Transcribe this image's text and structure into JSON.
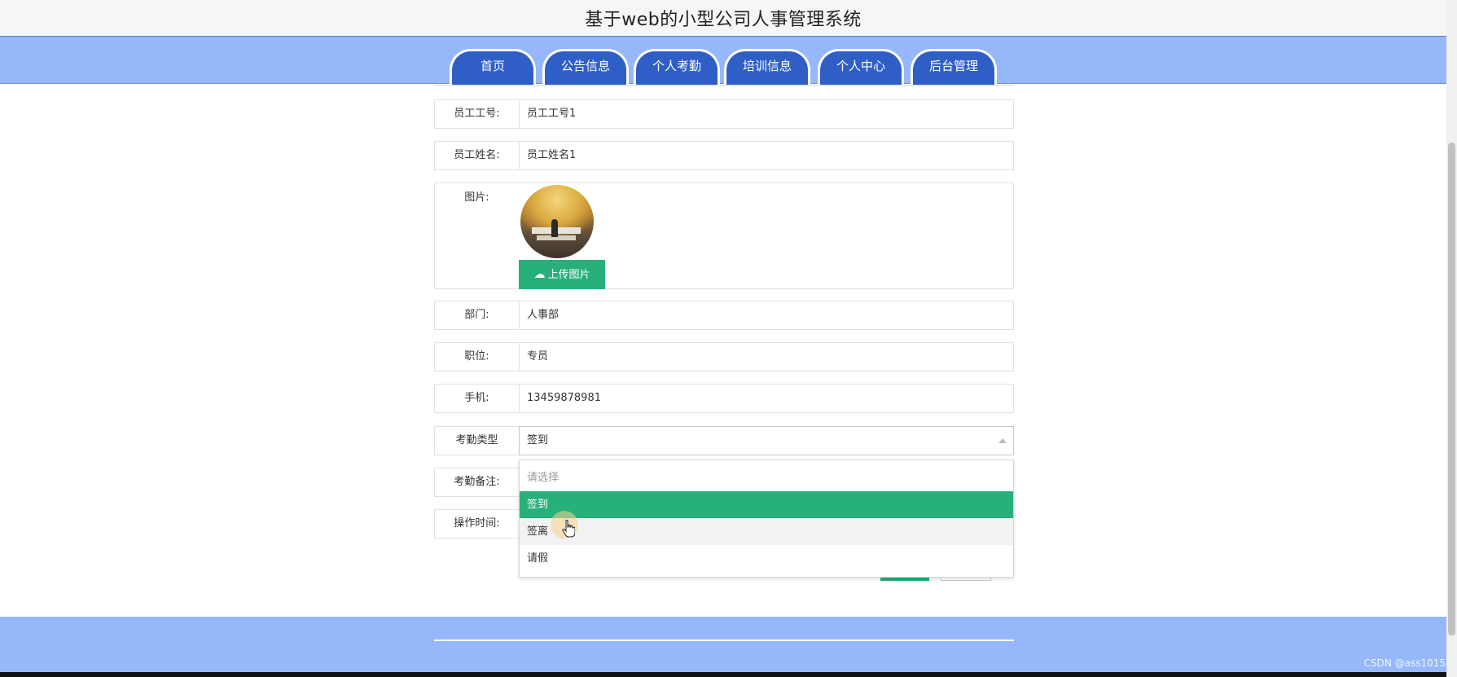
{
  "header": {
    "site_title": "基于web的小型公司人事管理系统"
  },
  "nav": {
    "tabs": [
      "首页",
      "公告信息",
      "个人考勤",
      "培训信息",
      "个人中心",
      "后台管理"
    ]
  },
  "form": {
    "employee_id": {
      "label": "员工工号:",
      "value": "员工工号1"
    },
    "employee_name": {
      "label": "员工姓名:",
      "value": "员工姓名1"
    },
    "image": {
      "label": "图片:",
      "upload_label": "上传图片"
    },
    "department": {
      "label": "部门:",
      "value": "人事部"
    },
    "position": {
      "label": "职位:",
      "value": "专员"
    },
    "phone": {
      "label": "手机:",
      "value": "13459878981"
    },
    "attendance_type": {
      "label": "考勤类型",
      "value": "签到"
    },
    "attendance_note": {
      "label": "考勤备注:"
    },
    "operation_time": {
      "label": "操作时间:"
    }
  },
  "dropdown": {
    "placeholder": "请选择",
    "options": [
      "签到",
      "签离",
      "请假"
    ],
    "selected": "签到",
    "hovered": "签离"
  },
  "colors": {
    "nav_bg": "#96b8fa",
    "tab_bg": "#2f5fc6",
    "accent_green": "#27b07a"
  },
  "watermark": "CSDN @ass1015"
}
